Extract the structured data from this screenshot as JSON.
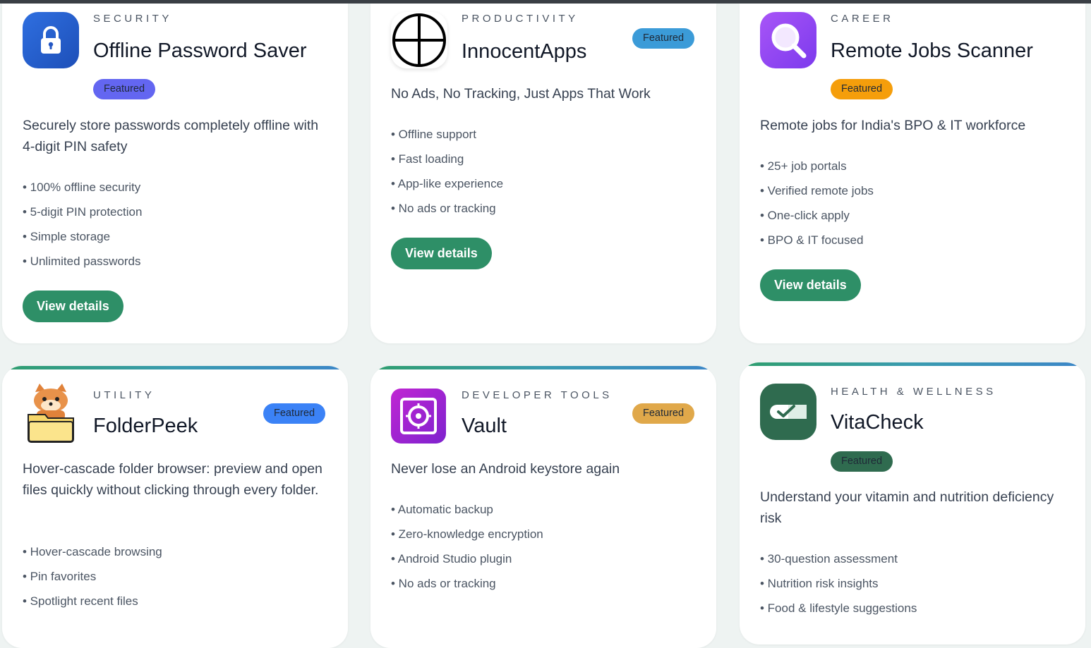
{
  "cards": [
    {
      "category": "SECURITY",
      "title": "Offline Password Saver",
      "badge": "Featured",
      "description": "Securely store passwords completely offline with 4-digit PIN safety",
      "features": [
        "• 100% offline security",
        "• 5-digit PIN protection",
        "• Simple storage",
        "• Unlimited passwords"
      ],
      "button": "View details",
      "icon": "lock-icon",
      "badge_color": "#6366f1"
    },
    {
      "category": "PRODUCTIVITY",
      "title": "InnocentApps",
      "badge": "Featured",
      "description": "No Ads, No Tracking, Just Apps That Work",
      "features": [
        "• Offline support",
        "• Fast loading",
        "• App-like experience",
        "• No ads or tracking"
      ],
      "button": "View details",
      "icon": "circle-cross-icon",
      "badge_color": "#3b9bd8"
    },
    {
      "category": "CAREER",
      "title": "Remote Jobs Scanner",
      "badge": "Featured",
      "description": "Remote jobs for India's BPO & IT workforce",
      "features": [
        "• 25+ job portals",
        "• Verified remote jobs",
        "• One-click apply",
        "• BPO & IT focused"
      ],
      "button": "View details",
      "icon": "magnifier-icon",
      "badge_color": "#f59e0b"
    },
    {
      "category": "UTILITY",
      "title": "FolderPeek",
      "badge": "Featured",
      "description": "Hover-cascade folder browser: preview and open files quickly without clicking through every folder.",
      "features": [
        "• Hover-cascade browsing",
        "• Pin favorites",
        "• Spotlight recent files"
      ],
      "icon": "fox-folder-icon",
      "badge_color": "#3b82f6"
    },
    {
      "category": "DEVELOPER TOOLS",
      "title": "Vault",
      "badge": "Featured",
      "description": "Never lose an Android keystore again",
      "features": [
        "• Automatic backup",
        "• Zero-knowledge encryption",
        "• Android Studio plugin",
        "• No ads or tracking"
      ],
      "icon": "vault-icon",
      "badge_color": "#e0a84a"
    },
    {
      "category": "HEALTH & WELLNESS",
      "title": "VitaCheck",
      "badge": "Featured",
      "description": "Understand your vitamin and nutrition deficiency risk",
      "features": [
        "• 30-question assessment",
        "• Nutrition risk insights",
        "• Food & lifestyle suggestions"
      ],
      "icon": "pill-check-icon",
      "badge_color": "#2f6b4f"
    }
  ]
}
